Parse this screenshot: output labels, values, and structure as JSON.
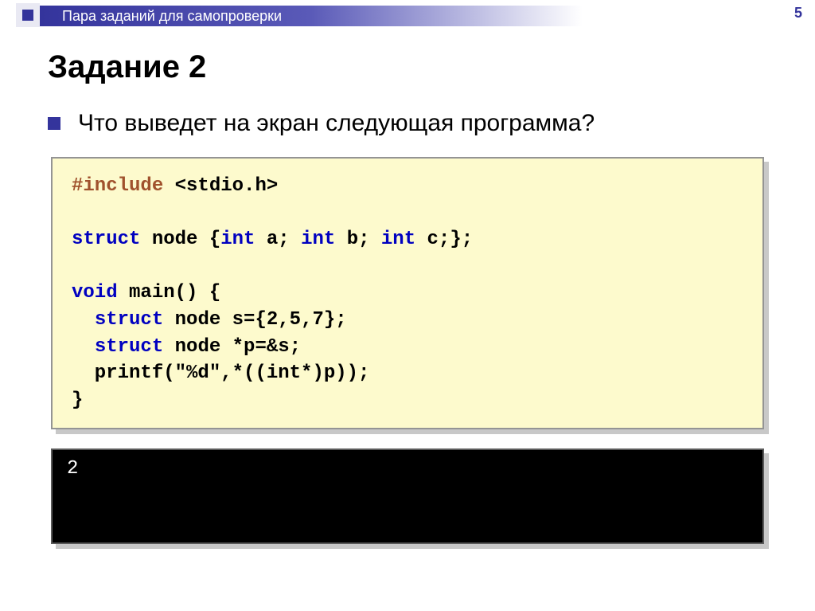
{
  "header": {
    "subtitle": "Пара заданий для самопроверки",
    "page_number": "5"
  },
  "title": "Задание 2",
  "question": "Что выведет на экран следующая программа?",
  "code": {
    "l1a": "#include",
    "l1b": " <stdio.h>",
    "l2a": "struct",
    "l2b": " node {",
    "l2c": "int",
    "l2d": " a; ",
    "l2e": "int",
    "l2f": " b; ",
    "l2g": "int",
    "l2h": " c;};",
    "l3a": "void",
    "l3b": " main() {",
    "l4a": "  ",
    "l4b": "struct",
    "l4c": " node s={2,5,7};",
    "l5a": "  ",
    "l5b": "struct",
    "l5c": " node *p=&s;",
    "l6": "  printf(\"%d\",*((int*)p));",
    "l7": "}"
  },
  "output": "2"
}
